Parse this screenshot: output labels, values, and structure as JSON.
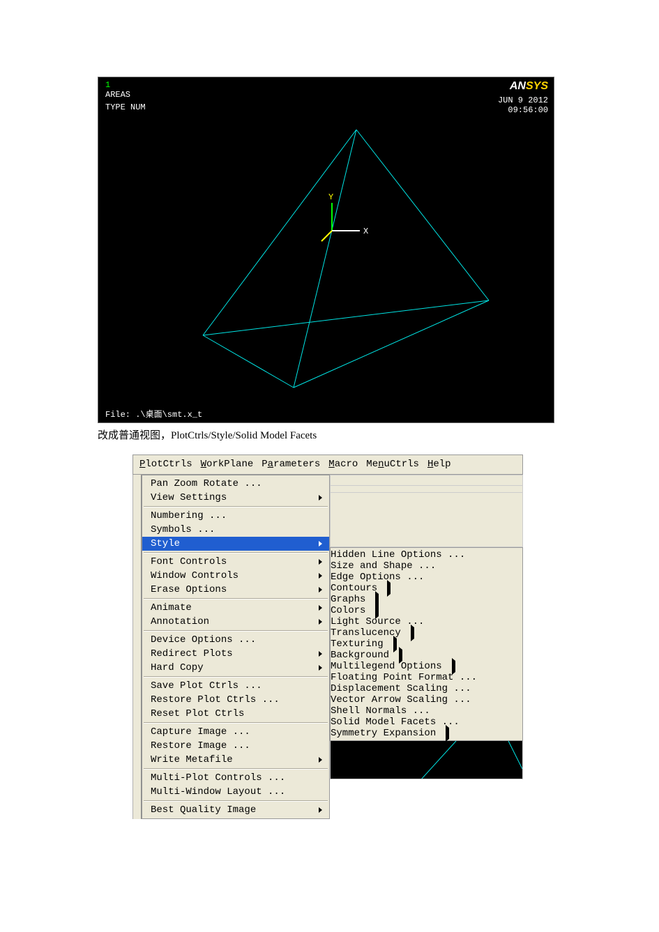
{
  "viewport": {
    "top_index": "1",
    "areas": "AREAS",
    "typenum": "TYPE NUM",
    "logo_an": "AN",
    "logo_sys": "SYS",
    "date": "JUN  9 2012",
    "time": "09:56:00",
    "file": "File: .\\桌面\\smt.x_t",
    "axis_y": "Y",
    "axis_x": "X"
  },
  "caption": "改成普通视图，PlotCtrls/Style/Solid Model Facets",
  "menubar": {
    "items": [
      "PlotCtrls",
      "WorkPlane",
      "Parameters",
      "Macro",
      "MenuCtrls",
      "Help"
    ]
  },
  "dropdown": {
    "groups": [
      [
        {
          "label": "Pan Zoom Rotate ...",
          "sub": false
        },
        {
          "label": "View Settings",
          "sub": true
        }
      ],
      [
        {
          "label": "Numbering ...",
          "sub": false
        },
        {
          "label": "Symbols ...",
          "sub": false
        },
        {
          "label": "Style",
          "sub": true,
          "selected": true
        }
      ],
      [
        {
          "label": "Font Controls",
          "sub": true
        },
        {
          "label": "Window Controls",
          "sub": true
        },
        {
          "label": "Erase Options",
          "sub": true
        }
      ],
      [
        {
          "label": "Animate",
          "sub": true
        },
        {
          "label": "Annotation",
          "sub": true
        }
      ],
      [
        {
          "label": "Device Options ...",
          "sub": false
        },
        {
          "label": "Redirect Plots",
          "sub": true
        },
        {
          "label": "Hard Copy",
          "sub": true
        }
      ],
      [
        {
          "label": "Save Plot Ctrls ...",
          "sub": false
        },
        {
          "label": "Restore Plot Ctrls ...",
          "sub": false
        },
        {
          "label": "Reset Plot Ctrls",
          "sub": false
        }
      ],
      [
        {
          "label": "Capture Image ...",
          "sub": false
        },
        {
          "label": "Restore Image ...",
          "sub": false
        },
        {
          "label": "Write Metafile",
          "sub": true
        }
      ],
      [
        {
          "label": "Multi-Plot Controls ...",
          "sub": false
        },
        {
          "label": "Multi-Window Layout ...",
          "sub": false
        }
      ],
      [
        {
          "label": "Best Quality Image",
          "sub": true
        }
      ]
    ]
  },
  "submenu": {
    "groups": [
      [
        {
          "label": "Hidden Line Options ...",
          "sub": false
        },
        {
          "label": "Size and Shape     ...",
          "sub": false
        },
        {
          "label": "Edge Options       ...",
          "sub": false
        }
      ],
      [
        {
          "label": "Contours",
          "sub": true
        },
        {
          "label": "Graphs",
          "sub": true
        },
        {
          "label": "Colors",
          "sub": true
        }
      ],
      [
        {
          "label": "Light Source  ...",
          "sub": false
        },
        {
          "label": "Translucency",
          "sub": true
        },
        {
          "label": "Texturing",
          "sub": true
        }
      ],
      [
        {
          "label": "Background",
          "sub": true
        },
        {
          "label": "Multilegend Options",
          "sub": true
        },
        {
          "label": "Floating Point Format ...",
          "sub": false
        }
      ],
      [
        {
          "label": "Displacement Scaling ...",
          "sub": false
        },
        {
          "label": "Vector Arrow Scaling ...",
          "sub": false
        }
      ],
      [
        {
          "label": "Shell Normals ...",
          "sub": false
        },
        {
          "label": "Solid Model Facets ...",
          "sub": false,
          "selected": true
        },
        {
          "label": "Symmetry Expansion",
          "sub": true
        }
      ]
    ]
  }
}
